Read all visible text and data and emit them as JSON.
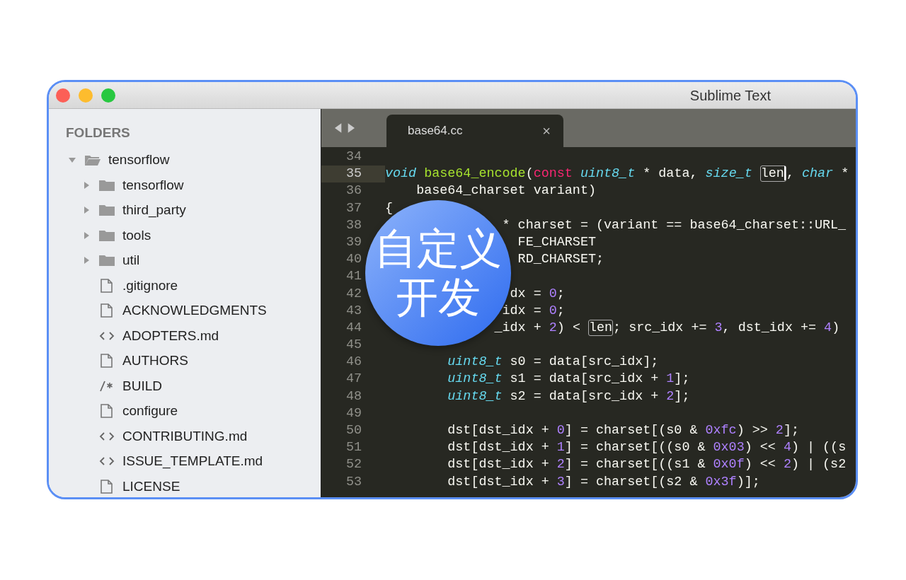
{
  "window": {
    "title": "Sublime Text"
  },
  "sidebar": {
    "heading": "FOLDERS",
    "tree": [
      {
        "label": "tensorflow",
        "kind": "folder",
        "expanded": true,
        "children": [
          {
            "label": "tensorflow",
            "kind": "folder",
            "expanded": false
          },
          {
            "label": "third_party",
            "kind": "folder",
            "expanded": false
          },
          {
            "label": "tools",
            "kind": "folder",
            "expanded": false
          },
          {
            "label": "util",
            "kind": "folder",
            "expanded": false
          },
          {
            "label": ".gitignore",
            "kind": "file"
          },
          {
            "label": "ACKNOWLEDGMENTS",
            "kind": "file"
          },
          {
            "label": "ADOPTERS.md",
            "kind": "markup"
          },
          {
            "label": "AUTHORS",
            "kind": "file"
          },
          {
            "label": "BUILD",
            "kind": "comment"
          },
          {
            "label": "configure",
            "kind": "file"
          },
          {
            "label": "CONTRIBUTING.md",
            "kind": "markup"
          },
          {
            "label": "ISSUE_TEMPLATE.md",
            "kind": "markup"
          },
          {
            "label": "LICENSE",
            "kind": "file"
          }
        ]
      }
    ]
  },
  "tabs": [
    {
      "label": "base64.cc",
      "close": "×",
      "selected": true
    }
  ],
  "code": [
    {
      "number": "34",
      "current": false
    },
    {
      "number": "35",
      "current": true,
      "tokens": [
        {
          "text": "void ",
          "kind": "type"
        },
        {
          "text": "base64_encode",
          "kind": "func"
        },
        {
          "text": "(",
          "kind": "plain"
        },
        {
          "text": "const ",
          "kind": "keyword"
        },
        {
          "text": "uint8_t",
          "kind": "type"
        },
        {
          "text": " * data, ",
          "kind": "plain"
        },
        {
          "text": "size_t ",
          "kind": "type"
        },
        {
          "text": "len",
          "kind": "match",
          "caret": true
        },
        {
          "text": ", ",
          "kind": "plain"
        },
        {
          "text": "char",
          "kind": "type"
        },
        {
          "text": " *",
          "kind": "plain"
        }
      ]
    },
    {
      "number": "36",
      "current": false,
      "tokens": [
        {
          "text": "    base64_charset variant)",
          "kind": "plain"
        }
      ]
    },
    {
      "number": "37",
      "current": false,
      "tokens": [
        {
          "text": "{",
          "kind": "plain"
        }
      ]
    },
    {
      "number": "38",
      "current": false,
      "tokens": [
        {
          "text": "               * charset = (variant == base64_charset::URL_",
          "kind": "plain"
        }
      ]
    },
    {
      "number": "39",
      "current": false,
      "tokens": [
        {
          "text": "                 FE_CHARSET",
          "kind": "plain"
        }
      ]
    },
    {
      "number": "40",
      "current": false,
      "tokens": [
        {
          "text": "                 RD_CHARSET;",
          "kind": "plain"
        }
      ]
    },
    {
      "number": "41",
      "current": false
    },
    {
      "number": "42",
      "current": false,
      "tokens": [
        {
          "text": "                dx = ",
          "kind": "plain"
        },
        {
          "text": "0",
          "kind": "number"
        },
        {
          "text": ";",
          "kind": "plain"
        }
      ]
    },
    {
      "number": "43",
      "current": false,
      "tokens": [
        {
          "text": "               idx = ",
          "kind": "plain"
        },
        {
          "text": "0",
          "kind": "number"
        },
        {
          "text": ";",
          "kind": "plain"
        }
      ]
    },
    {
      "number": "44",
      "current": false,
      "tokens": [
        {
          "text": "              _idx + ",
          "kind": "plain"
        },
        {
          "text": "2",
          "kind": "number"
        },
        {
          "text": ") < ",
          "kind": "plain"
        },
        {
          "text": "len",
          "kind": "match"
        },
        {
          "text": "; src_idx += ",
          "kind": "plain"
        },
        {
          "text": "3",
          "kind": "number"
        },
        {
          "text": ", dst_idx += ",
          "kind": "plain"
        },
        {
          "text": "4",
          "kind": "number"
        },
        {
          "text": ")",
          "kind": "plain"
        }
      ]
    },
    {
      "number": "45",
      "current": false
    },
    {
      "number": "46",
      "current": false,
      "tokens": [
        {
          "text": "        uint8_t",
          "kind": "type"
        },
        {
          "text": " s0 = data[src_idx];",
          "kind": "plain"
        }
      ]
    },
    {
      "number": "47",
      "current": false,
      "tokens": [
        {
          "text": "        uint8_t",
          "kind": "type"
        },
        {
          "text": " s1 = data[src_idx + ",
          "kind": "plain"
        },
        {
          "text": "1",
          "kind": "number"
        },
        {
          "text": "];",
          "kind": "plain"
        }
      ]
    },
    {
      "number": "48",
      "current": false,
      "tokens": [
        {
          "text": "        uint8_t",
          "kind": "type"
        },
        {
          "text": " s2 = data[src_idx + ",
          "kind": "plain"
        },
        {
          "text": "2",
          "kind": "number"
        },
        {
          "text": "];",
          "kind": "plain"
        }
      ]
    },
    {
      "number": "49",
      "current": false
    },
    {
      "number": "50",
      "current": false,
      "tokens": [
        {
          "text": "        dst[dst_idx + ",
          "kind": "plain"
        },
        {
          "text": "0",
          "kind": "number"
        },
        {
          "text": "] = charset[(s0 & ",
          "kind": "plain"
        },
        {
          "text": "0xfc",
          "kind": "number"
        },
        {
          "text": ") >> ",
          "kind": "plain"
        },
        {
          "text": "2",
          "kind": "number"
        },
        {
          "text": "];",
          "kind": "plain"
        }
      ]
    },
    {
      "number": "51",
      "current": false,
      "tokens": [
        {
          "text": "        dst[dst_idx + ",
          "kind": "plain"
        },
        {
          "text": "1",
          "kind": "number"
        },
        {
          "text": "] = charset[((s0 & ",
          "kind": "plain"
        },
        {
          "text": "0x03",
          "kind": "number"
        },
        {
          "text": ") << ",
          "kind": "plain"
        },
        {
          "text": "4",
          "kind": "number"
        },
        {
          "text": ") | ((s",
          "kind": "plain"
        }
      ]
    },
    {
      "number": "52",
      "current": false,
      "tokens": [
        {
          "text": "        dst[dst_idx + ",
          "kind": "plain"
        },
        {
          "text": "2",
          "kind": "number"
        },
        {
          "text": "] = charset[((s1 & ",
          "kind": "plain"
        },
        {
          "text": "0x0f",
          "kind": "number"
        },
        {
          "text": ") << ",
          "kind": "plain"
        },
        {
          "text": "2",
          "kind": "number"
        },
        {
          "text": ") | (s2",
          "kind": "plain"
        }
      ]
    },
    {
      "number": "53",
      "current": false,
      "tokens": [
        {
          "text": "        dst[dst_idx + ",
          "kind": "plain"
        },
        {
          "text": "3",
          "kind": "number"
        },
        {
          "text": "] = charset[(s2 & ",
          "kind": "plain"
        },
        {
          "text": "0x3f",
          "kind": "number"
        },
        {
          "text": ")];",
          "kind": "plain"
        }
      ]
    }
  ],
  "overlay": {
    "text": "自定义开发"
  }
}
